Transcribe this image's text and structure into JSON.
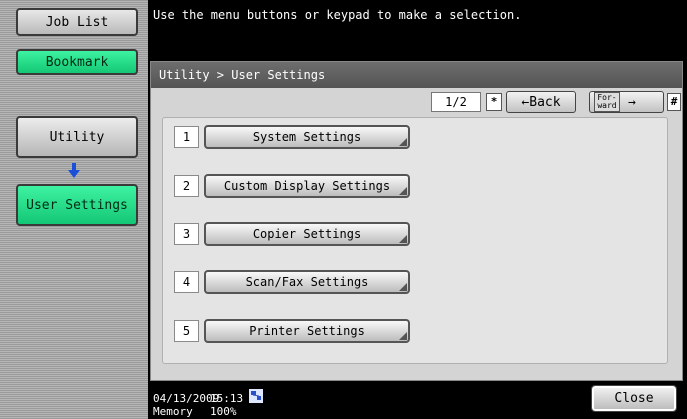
{
  "sidebar": {
    "job_list": "Job List",
    "bookmark": "Bookmark",
    "utility": "Utility",
    "user_settings": "User Settings"
  },
  "message": "Use the menu buttons or keypad to make a selection.",
  "breadcrumb": "Utility > User Settings",
  "pager": {
    "page": "1/2",
    "star_key": "*",
    "back_label": "←Back",
    "forward_label": "For-\nward",
    "forward_arrow": "→",
    "hash_key": "#"
  },
  "menu": [
    {
      "num": "1",
      "label": "System Settings"
    },
    {
      "num": "2",
      "label": "Custom Display Settings"
    },
    {
      "num": "3",
      "label": "Copier Settings"
    },
    {
      "num": "4",
      "label": "Scan/Fax Settings"
    },
    {
      "num": "5",
      "label": "Printer Settings"
    }
  ],
  "status": {
    "date": "04/13/2009",
    "time": "15:13",
    "memory_label": "Memory",
    "memory_value": "100%",
    "network_icon": "network-icon"
  },
  "close_label": "Close",
  "colors": {
    "accent_green": "#13c774",
    "background": "#000000",
    "panel": "#d4d4d4"
  }
}
